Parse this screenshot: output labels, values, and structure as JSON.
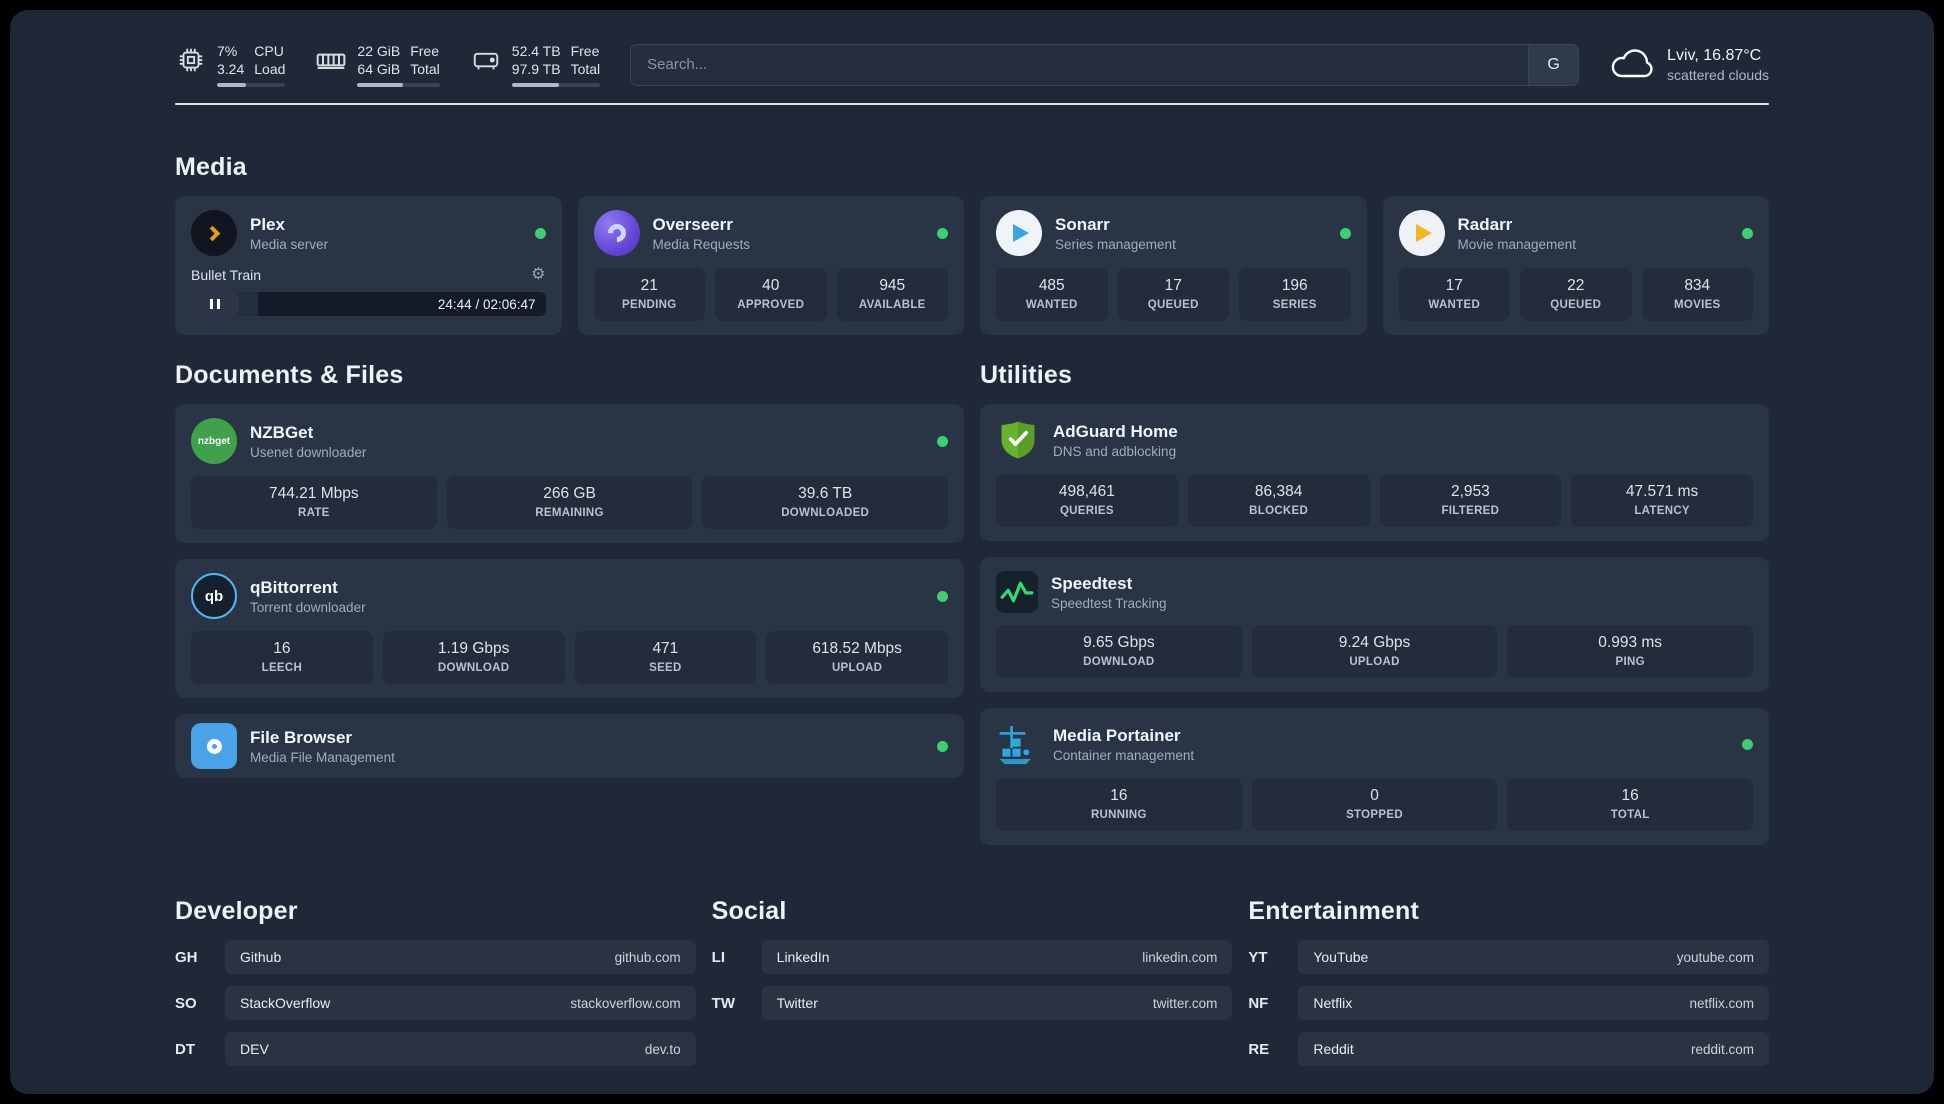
{
  "colors": {
    "status-online": "#3ecf72",
    "plex-amber": "#e5a00d",
    "overseerr-purple": "#5d3fd3",
    "sonarr-blue": "#35a8e0",
    "radarr-amber": "#f5b423",
    "nzbget-green": "#3fa24a",
    "qbittorrent-blue": "#52b7f0",
    "filebrowser-blue": "#4aa3e8",
    "adguard-green": "#67b32e",
    "speedtest-green": "#2fdc76",
    "portainer-blue": "#29abe2"
  },
  "topbar": {
    "cpu": {
      "usage": "7%",
      "load": "3.24",
      "label_top": "CPU",
      "label_bottom": "Load",
      "bar_percent": 42
    },
    "ram": {
      "free": "22 GiB",
      "total": "64 GiB",
      "label_top": "Free",
      "label_bottom": "Total",
      "bar_percent": 55
    },
    "disk": {
      "free": "52.4 TB",
      "total": "97.9 TB",
      "label_top": "Free",
      "label_bottom": "Total",
      "bar_percent": 53
    },
    "search": {
      "placeholder": "Search...",
      "engine_label": "G"
    },
    "weather": {
      "location": "Lviv, 16.87°C",
      "condition": "scattered clouds"
    }
  },
  "media": {
    "title": "Media",
    "plex": {
      "name": "Plex",
      "subtitle": "Media server",
      "now_playing": "Bullet Train",
      "time": "24:44 / 02:06:47",
      "progress_percent": 19
    },
    "overseerr": {
      "name": "Overseerr",
      "subtitle": "Media Requests",
      "stats": [
        {
          "value": "21",
          "label": "PENDING"
        },
        {
          "value": "40",
          "label": "APPROVED"
        },
        {
          "value": "945",
          "label": "AVAILABLE"
        }
      ]
    },
    "sonarr": {
      "name": "Sonarr",
      "subtitle": "Series management",
      "stats": [
        {
          "value": "485",
          "label": "WANTED"
        },
        {
          "value": "17",
          "label": "QUEUED"
        },
        {
          "value": "196",
          "label": "SERIES"
        }
      ]
    },
    "radarr": {
      "name": "Radarr",
      "subtitle": "Movie management",
      "stats": [
        {
          "value": "17",
          "label": "WANTED"
        },
        {
          "value": "22",
          "label": "QUEUED"
        },
        {
          "value": "834",
          "label": "MOVIES"
        }
      ]
    }
  },
  "documents": {
    "title": "Documents & Files",
    "nzbget": {
      "name": "NZBGet",
      "subtitle": "Usenet downloader",
      "icon_text": "nzbget",
      "stats": [
        {
          "value": "744.21 Mbps",
          "label": "RATE"
        },
        {
          "value": "266 GB",
          "label": "REMAINING"
        },
        {
          "value": "39.6 TB",
          "label": "DOWNLOADED"
        }
      ]
    },
    "qbittorrent": {
      "name": "qBittorrent",
      "subtitle": "Torrent downloader",
      "icon_text": "qb",
      "stats": [
        {
          "value": "16",
          "label": "LEECH"
        },
        {
          "value": "1.19 Gbps",
          "label": "DOWNLOAD"
        },
        {
          "value": "471",
          "label": "SEED"
        },
        {
          "value": "618.52 Mbps",
          "label": "UPLOAD"
        }
      ]
    },
    "filebrowser": {
      "name": "File Browser",
      "subtitle": "Media File Management"
    }
  },
  "utilities": {
    "title": "Utilities",
    "adguard": {
      "name": "AdGuard Home",
      "subtitle": "DNS and adblocking",
      "stats": [
        {
          "value": "498,461",
          "label": "QUERIES"
        },
        {
          "value": "86,384",
          "label": "BLOCKED"
        },
        {
          "value": "2,953",
          "label": "FILTERED"
        },
        {
          "value": "47.571 ms",
          "label": "LATENCY"
        }
      ]
    },
    "speedtest": {
      "name": "Speedtest",
      "subtitle": "Speedtest Tracking",
      "stats": [
        {
          "value": "9.65 Gbps",
          "label": "DOWNLOAD"
        },
        {
          "value": "9.24 Gbps",
          "label": "UPLOAD"
        },
        {
          "value": "0.993 ms",
          "label": "PING"
        }
      ]
    },
    "portainer": {
      "name": "Media Portainer",
      "subtitle": "Container management",
      "stats": [
        {
          "value": "16",
          "label": "RUNNING"
        },
        {
          "value": "0",
          "label": "STOPPED"
        },
        {
          "value": "16",
          "label": "TOTAL"
        }
      ]
    }
  },
  "bookmarks": {
    "developer": {
      "title": "Developer",
      "items": [
        {
          "abbr": "GH",
          "name": "Github",
          "url": "github.com"
        },
        {
          "abbr": "SO",
          "name": "StackOverflow",
          "url": "stackoverflow.com"
        },
        {
          "abbr": "DT",
          "name": "DEV",
          "url": "dev.to"
        }
      ]
    },
    "social": {
      "title": "Social",
      "items": [
        {
          "abbr": "LI",
          "name": "LinkedIn",
          "url": "linkedin.com"
        },
        {
          "abbr": "TW",
          "name": "Twitter",
          "url": "twitter.com"
        }
      ]
    },
    "entertainment": {
      "title": "Entertainment",
      "items": [
        {
          "abbr": "YT",
          "name": "YouTube",
          "url": "youtube.com"
        },
        {
          "abbr": "NF",
          "name": "Netflix",
          "url": "netflix.com"
        },
        {
          "abbr": "RE",
          "name": "Reddit",
          "url": "reddit.com"
        }
      ]
    }
  }
}
